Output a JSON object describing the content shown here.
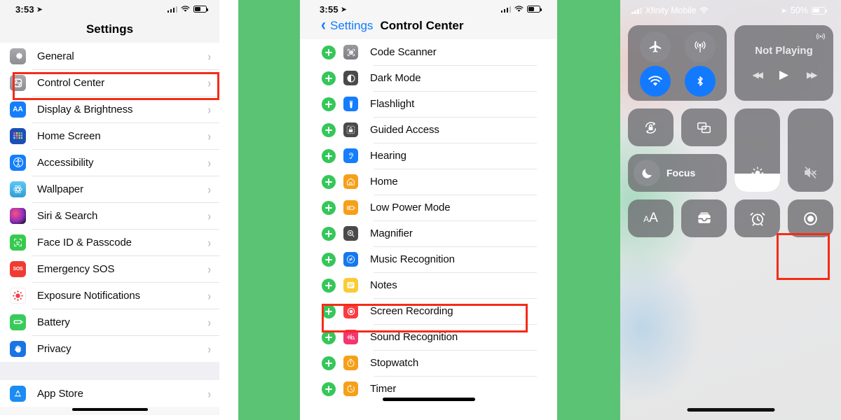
{
  "phone_settings": {
    "status_bar": {
      "time": "3:53",
      "location_icon": "location-arrow-icon",
      "wifi_icon": "wifi-icon",
      "battery_icon": "battery-icon"
    },
    "title": "Settings",
    "groups": [
      {
        "items": [
          {
            "label": "General",
            "icon": "gear-icon",
            "highlighted": false
          },
          {
            "label": "Control Center",
            "icon": "control-center-icon",
            "highlighted": true
          },
          {
            "label": "Display & Brightness",
            "icon": "display-brightness-icon",
            "highlighted": false
          },
          {
            "label": "Home Screen",
            "icon": "home-screen-icon",
            "highlighted": false
          },
          {
            "label": "Accessibility",
            "icon": "accessibility-icon",
            "highlighted": false
          },
          {
            "label": "Wallpaper",
            "icon": "wallpaper-icon",
            "highlighted": false
          },
          {
            "label": "Siri & Search",
            "icon": "siri-icon",
            "highlighted": false
          },
          {
            "label": "Face ID & Passcode",
            "icon": "face-id-icon",
            "highlighted": false
          },
          {
            "label": "Emergency SOS",
            "icon": "sos-icon",
            "highlighted": false
          },
          {
            "label": "Exposure Notifications",
            "icon": "exposure-notifications-icon",
            "highlighted": false
          },
          {
            "label": "Battery",
            "icon": "battery-icon",
            "highlighted": false
          },
          {
            "label": "Privacy",
            "icon": "privacy-hand-icon",
            "highlighted": false
          }
        ]
      },
      {
        "items": [
          {
            "label": "App Store",
            "icon": "app-store-icon",
            "highlighted": false
          }
        ]
      }
    ],
    "chevron": "›",
    "sos_icon_text": "SOS",
    "display_icon_text": "AA"
  },
  "phone_control_center_settings": {
    "status_bar": {
      "time": "3:55"
    },
    "nav": {
      "back_label": "Settings",
      "back_chevron": "‹",
      "title": "Control Center"
    },
    "more_controls": [
      {
        "label": "Code Scanner",
        "icon": "code-scanner-icon",
        "highlighted": false
      },
      {
        "label": "Dark Mode",
        "icon": "dark-mode-icon",
        "highlighted": false
      },
      {
        "label": "Flashlight",
        "icon": "flashlight-icon",
        "highlighted": false
      },
      {
        "label": "Guided Access",
        "icon": "guided-access-icon",
        "highlighted": false
      },
      {
        "label": "Hearing",
        "icon": "hearing-icon",
        "highlighted": false
      },
      {
        "label": "Home",
        "icon": "home-icon",
        "highlighted": false
      },
      {
        "label": "Low Power Mode",
        "icon": "low-power-mode-icon",
        "highlighted": false
      },
      {
        "label": "Magnifier",
        "icon": "magnifier-icon",
        "highlighted": false
      },
      {
        "label": "Music Recognition",
        "icon": "shazam-icon",
        "highlighted": false
      },
      {
        "label": "Notes",
        "icon": "notes-icon",
        "highlighted": false
      },
      {
        "label": "Screen Recording",
        "icon": "screen-recording-icon",
        "highlighted": true
      },
      {
        "label": "Sound Recognition",
        "icon": "sound-recognition-icon",
        "highlighted": false
      },
      {
        "label": "Stopwatch",
        "icon": "stopwatch-icon",
        "highlighted": false
      },
      {
        "label": "Timer",
        "icon": "timer-icon",
        "highlighted": false
      }
    ]
  },
  "phone_control_center": {
    "status_bar": {
      "carrier": "Xfinity Mobile",
      "battery_percent": "50%",
      "wifi_icon": "wifi-icon",
      "location_icon": "location-arrow-icon"
    },
    "connectivity": [
      {
        "name": "airplane-mode-toggle",
        "state": "off"
      },
      {
        "name": "cellular-data-toggle",
        "state": "off"
      },
      {
        "name": "wifi-toggle",
        "state": "on"
      },
      {
        "name": "bluetooth-toggle",
        "state": "on"
      }
    ],
    "media": {
      "title": "Not Playing",
      "airplay_icon": "airplay-icon",
      "prev_icon": "rewind-icon",
      "play_icon": "play-icon",
      "next_icon": "fast-forward-icon"
    },
    "tiles": [
      {
        "name": "rotation-lock-toggle",
        "icon": "rotation-lock-icon"
      },
      {
        "name": "screen-mirroring-button",
        "icon": "screen-mirroring-icon"
      },
      {
        "name": "focus-button",
        "icon": "moon-icon",
        "label": "Focus"
      },
      {
        "name": "brightness-slider",
        "icon": "brightness-icon",
        "value": 22
      },
      {
        "name": "volume-slider",
        "icon": "volume-mute-icon",
        "value": 0
      },
      {
        "name": "text-size-button",
        "icon": "text-size-icon",
        "label": "AA"
      },
      {
        "name": "wallet-button",
        "icon": "wallet-icon"
      },
      {
        "name": "alarm-button",
        "icon": "alarm-clock-icon"
      },
      {
        "name": "screen-recording-button",
        "icon": "screen-recording-icon",
        "highlighted": true
      }
    ]
  },
  "colors": {
    "background_green": "#5bc374",
    "highlight_red": "#f52b17",
    "ios_blue": "#117aff",
    "ios_green": "#34c759"
  }
}
